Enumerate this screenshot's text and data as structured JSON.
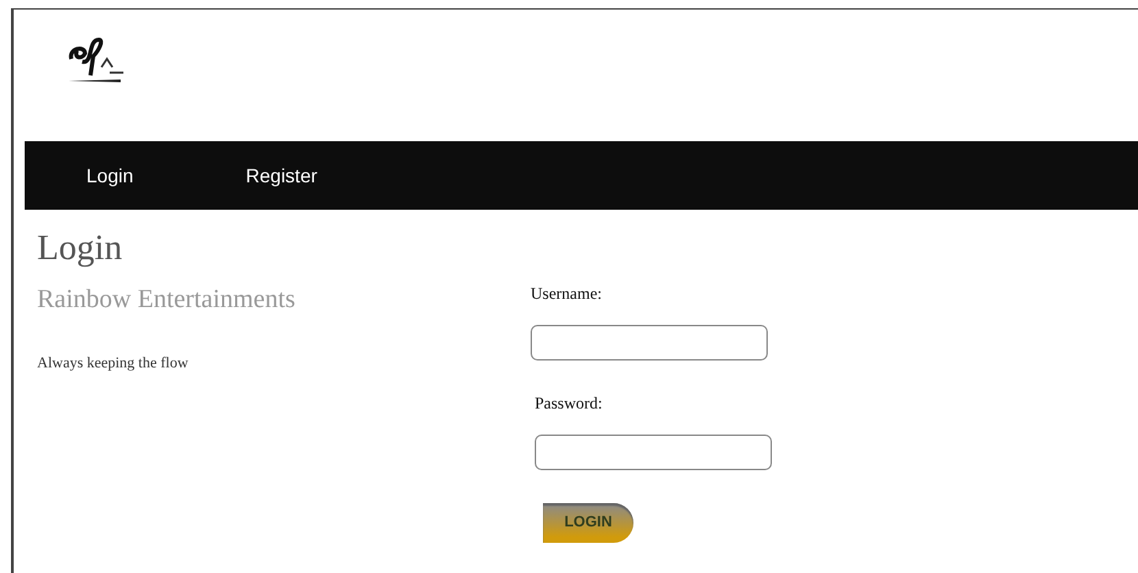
{
  "nav": [
    {
      "label": "Login"
    },
    {
      "label": "Register"
    }
  ],
  "heading": "Login",
  "company": "Rainbow Entertainments",
  "tagline": "Always keeping the flow",
  "form": {
    "fields": [
      {
        "label": "Username:"
      },
      {
        "label": "Password:"
      }
    ],
    "submit": "LOGIN"
  }
}
